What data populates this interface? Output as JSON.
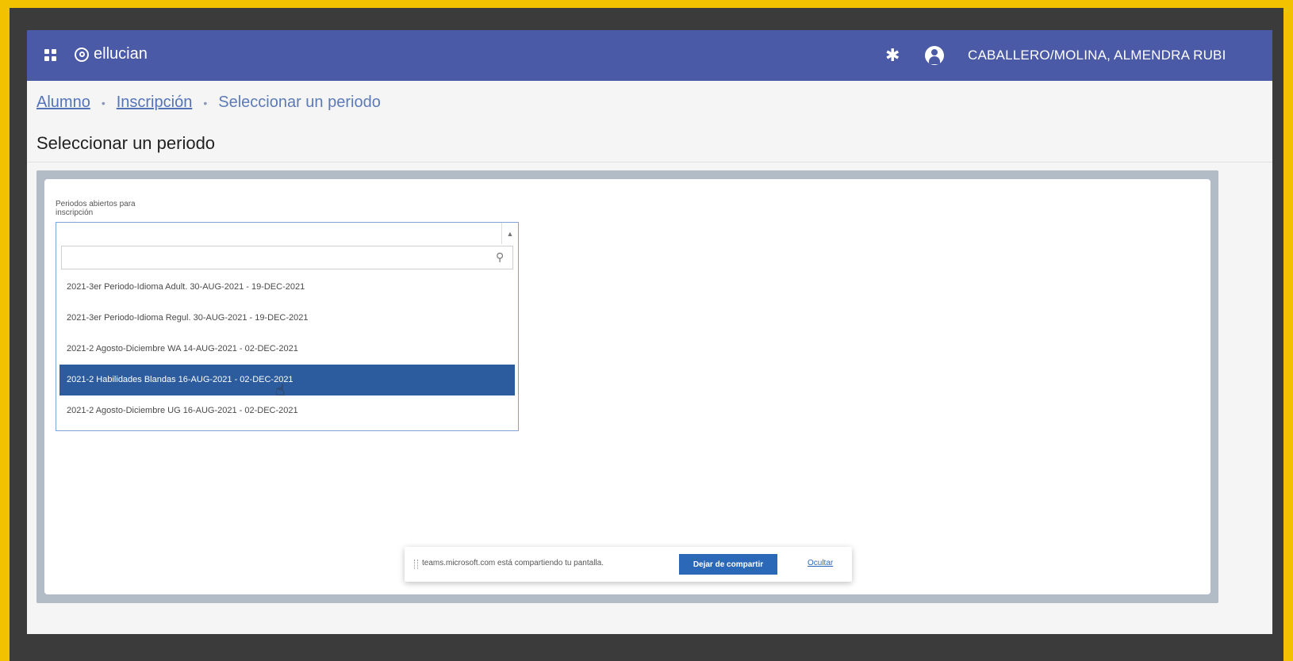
{
  "topbar": {
    "brand": "ellucian",
    "username": "CABALLERO/MOLINA, ALMENDRA RUBI"
  },
  "breadcrumb": {
    "items": [
      "Alumno",
      "Inscripción"
    ],
    "current": "Seleccionar un periodo"
  },
  "page": {
    "title": "Seleccionar un periodo"
  },
  "form": {
    "label": "Periodos abiertos para inscripción",
    "select_value": "",
    "search_value": "",
    "options": [
      "2021-3er Periodo-Idioma Adult. 30-AUG-2021 - 19-DEC-2021",
      "2021-3er Periodo-Idioma Regul. 30-AUG-2021 - 19-DEC-2021",
      "2021-2 Agosto-Diciembre WA 14-AUG-2021 - 02-DEC-2021",
      "2021-2 Habilidades Blandas 16-AUG-2021 - 02-DEC-2021",
      "2021-2 Agosto-Diciembre UG 16-AUG-2021 - 02-DEC-2021"
    ],
    "selected_index": 3
  },
  "share_bar": {
    "message": "teams.microsoft.com está compartiendo tu pantalla.",
    "stop_label": "Dejar de compartir",
    "hide_label": "Ocultar"
  },
  "colors": {
    "topbar": "#4a5aa6",
    "highlight": "#2c5b9e",
    "frame": "#f2c200"
  }
}
